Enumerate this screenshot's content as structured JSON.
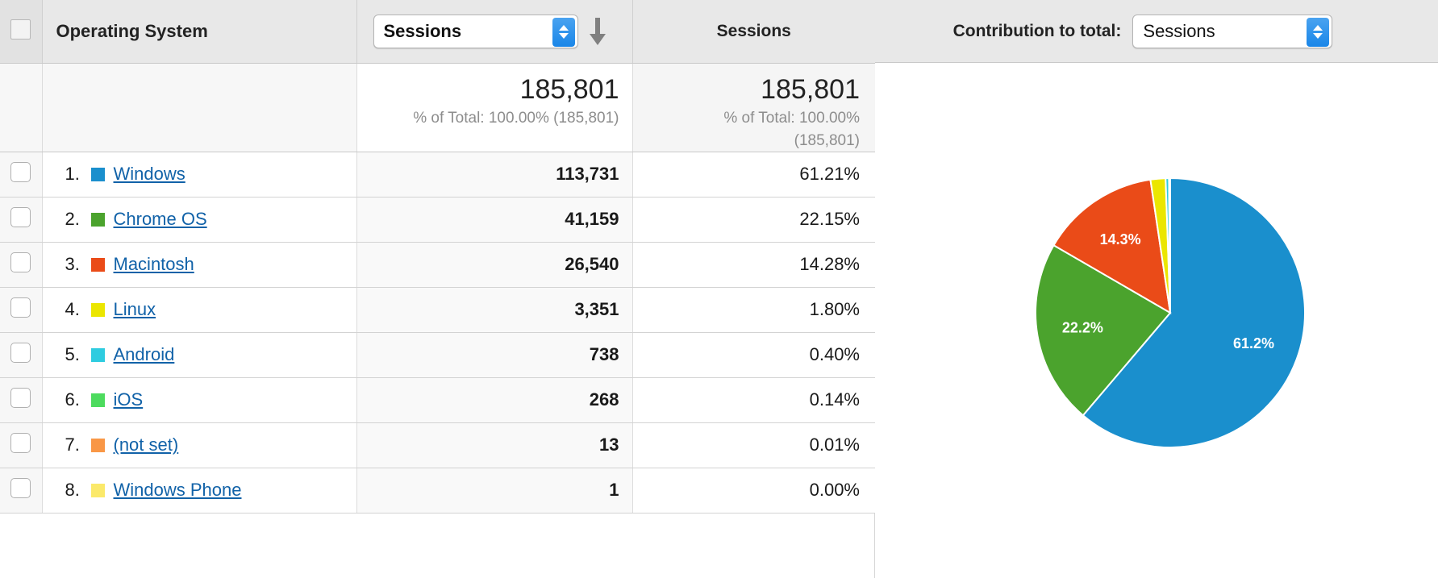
{
  "table": {
    "header": {
      "dimension_label": "Operating System",
      "metric_select_value": "Sessions",
      "pct_column_label": "Sessions",
      "sort_icon": "sort-descending-arrow-icon"
    },
    "summary": {
      "metric_total": "185,801",
      "metric_subtext": "% of Total: 100.00% (185,801)",
      "pct_total": "185,801",
      "pct_subtext_line1": "% of Total: 100.00%",
      "pct_subtext_line2": "(185,801)"
    },
    "columns": [
      "",
      "Operating System",
      "Sessions",
      "Sessions"
    ],
    "rows": [
      {
        "rank": "1.",
        "label": "Windows",
        "color": "#1a8fcd",
        "sessions": "113,731",
        "percent": "61.21%"
      },
      {
        "rank": "2.",
        "label": "Chrome OS",
        "color": "#4ba32d",
        "sessions": "41,159",
        "percent": "22.15%"
      },
      {
        "rank": "3.",
        "label": "Macintosh",
        "color": "#ea4b18",
        "sessions": "26,540",
        "percent": "14.28%"
      },
      {
        "rank": "4.",
        "label": "Linux",
        "color": "#ebe600",
        "sessions": "3,351",
        "percent": "1.80%"
      },
      {
        "rank": "5.",
        "label": "Android",
        "color": "#2ecce0",
        "sessions": "738",
        "percent": "0.40%"
      },
      {
        "rank": "6.",
        "label": "iOS",
        "color": "#4ddb5e",
        "sessions": "268",
        "percent": "0.14%"
      },
      {
        "rank": "7.",
        "label": "(not set)",
        "color": "#f99746",
        "sessions": "13",
        "percent": "0.01%"
      },
      {
        "rank": "8.",
        "label": "Windows Phone",
        "color": "#fbe96a",
        "sessions": "1",
        "percent": "0.00%"
      }
    ]
  },
  "pie_panel": {
    "control_label": "Contribution to total:",
    "select_value": "Sessions"
  },
  "chart_data": {
    "type": "pie",
    "title": "",
    "metric": "Sessions",
    "total": 185801,
    "categories": [
      "Windows",
      "Chrome OS",
      "Macintosh",
      "Linux",
      "Android",
      "iOS",
      "(not set)",
      "Windows Phone"
    ],
    "values": [
      113731,
      41159,
      26540,
      3351,
      738,
      268,
      13,
      1
    ],
    "percents": [
      61.21,
      22.15,
      14.28,
      1.8,
      0.4,
      0.14,
      0.01,
      0.0
    ],
    "colors": [
      "#1a8fcd",
      "#4ba32d",
      "#ea4b18",
      "#ebe600",
      "#2ecce0",
      "#4ddb5e",
      "#f99746",
      "#fbe96a"
    ],
    "visible_labels": [
      {
        "text": "61.2%",
        "category": "Windows"
      },
      {
        "text": "22.2%",
        "category": "Chrome OS"
      },
      {
        "text": "14.3%",
        "category": "Macintosh"
      }
    ],
    "legend": "none",
    "start_angle_deg": -90,
    "direction": "clockwise"
  }
}
